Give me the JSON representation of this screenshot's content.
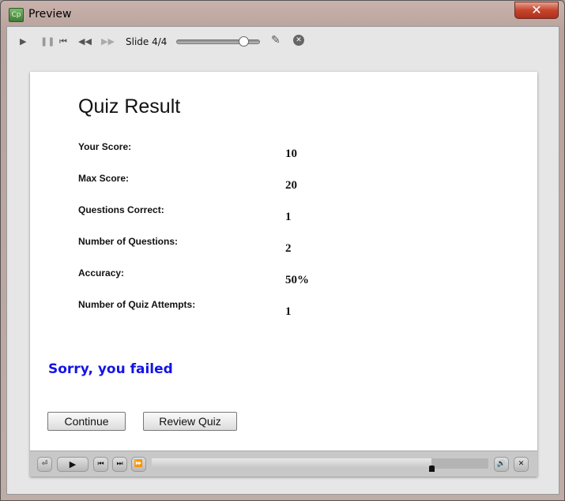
{
  "window": {
    "title": "Preview",
    "app_icon": "Cp",
    "close": "✕"
  },
  "toolbar": {
    "slide_label": "Slide 4/4",
    "scrubber_fraction": 0.8
  },
  "quiz": {
    "title": "Quiz Result",
    "rows": [
      {
        "label": "Your Score:",
        "value": "10"
      },
      {
        "label": "Max Score:",
        "value": "20"
      },
      {
        "label": "Questions Correct:",
        "value": "1"
      },
      {
        "label": "Number of Questions:",
        "value": "2"
      },
      {
        "label": "Accuracy:",
        "value": "50%"
      },
      {
        "label": "Number of Quiz Attempts:",
        "value": "1"
      }
    ],
    "message": "Sorry, you failed",
    "message_color": "#1414e6",
    "continue_label": "Continue",
    "review_label": "Review Quiz"
  },
  "playbar": {
    "progress_fraction": 0.83
  }
}
